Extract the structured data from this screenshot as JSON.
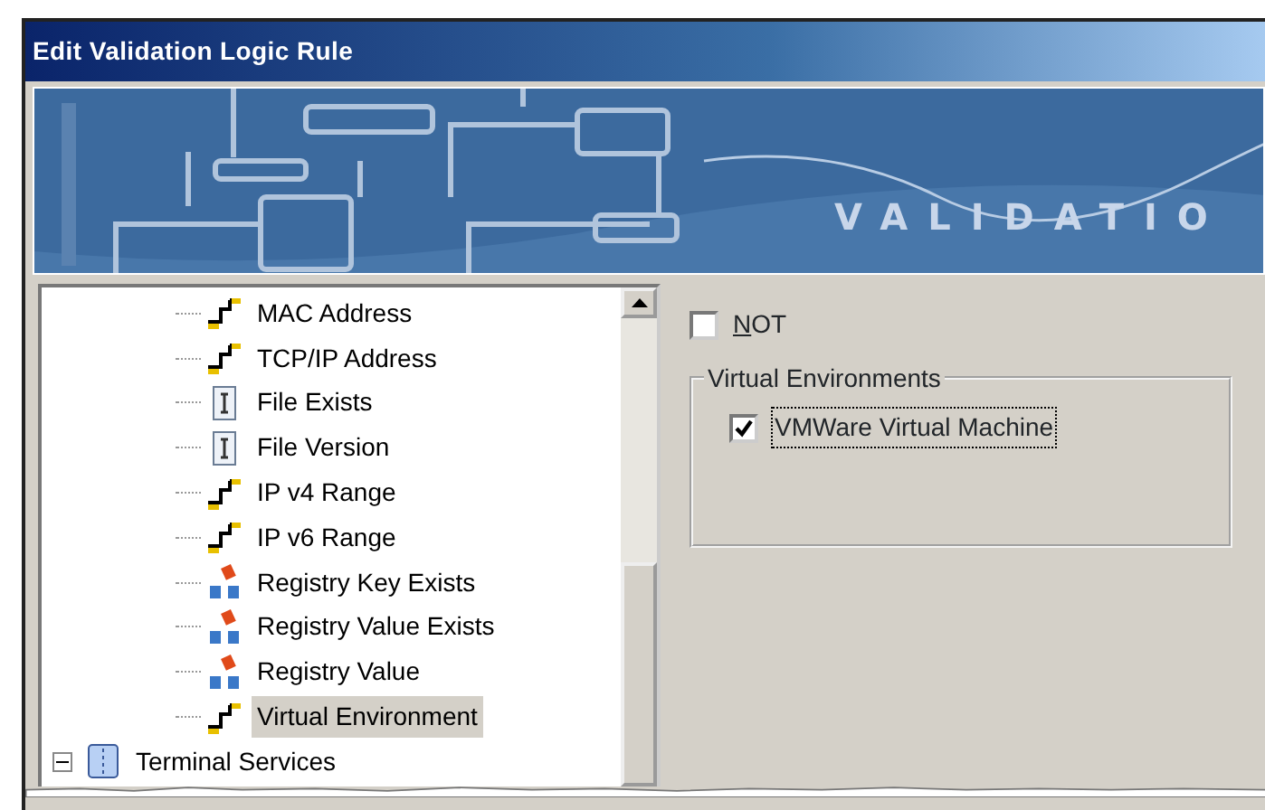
{
  "window": {
    "title": "Edit Validation Logic Rule"
  },
  "banner": {
    "kind": "picture",
    "title": "VALIDATIO"
  },
  "tree": {
    "nodes": [
      {
        "children": [
          {
            "label": "MAC Address",
            "kind": "network",
            "selected": false
          },
          {
            "label": "TCP/IP Address",
            "kind": "network",
            "selected": false
          },
          {
            "label": "File Exists",
            "kind": "file",
            "selected": false
          },
          {
            "label": "File Version",
            "kind": "file",
            "selected": false
          },
          {
            "label": "IP v4 Range",
            "kind": "network",
            "selected": false
          },
          {
            "label": "IP v6 Range",
            "kind": "network",
            "selected": false
          },
          {
            "label": "Registry Key Exists",
            "kind": "registry",
            "selected": false
          },
          {
            "label": "Registry Value Exists",
            "kind": "registry",
            "selected": false
          },
          {
            "label": "Registry Value",
            "kind": "registry",
            "selected": false
          },
          {
            "label": "Virtual Environment",
            "kind": "network",
            "selected": true
          }
        ]
      },
      {
        "label": "Terminal Services",
        "kind": "terminal",
        "selected": false,
        "expanded": true
      }
    ]
  },
  "not_option": {
    "label": "NOT",
    "checked": false
  },
  "group": {
    "title": "Virtual Environments",
    "options": [
      {
        "label": "VMWare Virtual Machine",
        "checked": true,
        "focused": true
      }
    ]
  }
}
